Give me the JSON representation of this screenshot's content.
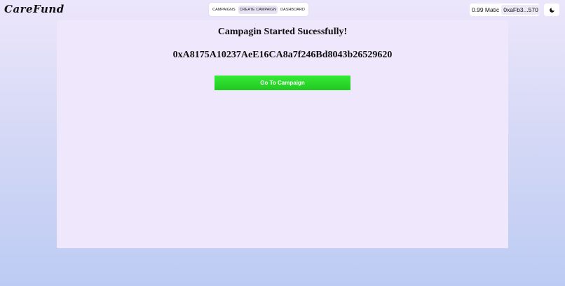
{
  "app": {
    "logo_text": "CareFund"
  },
  "nav": {
    "tabs": [
      {
        "label": "CAMPAIGNS",
        "active": false
      },
      {
        "label": "CREATE CAMPAIGN",
        "active": true
      },
      {
        "label": "DASHBOARD",
        "active": false
      }
    ]
  },
  "wallet": {
    "balance": "0.99 Matic",
    "address": "0xaFb3...570"
  },
  "theme_toggle": {
    "icon": "moon-icon"
  },
  "main": {
    "title": "Campagin Started Sucessfully!",
    "contract_address": "0xA8175A10237AeE16CA8a7f246Bd8043b26529620",
    "button_label": "Go To Campaign"
  },
  "colors": {
    "button_green": "#2ee02e",
    "panel_background": "#efe8fc",
    "active_tab": "#e7e2f4"
  }
}
